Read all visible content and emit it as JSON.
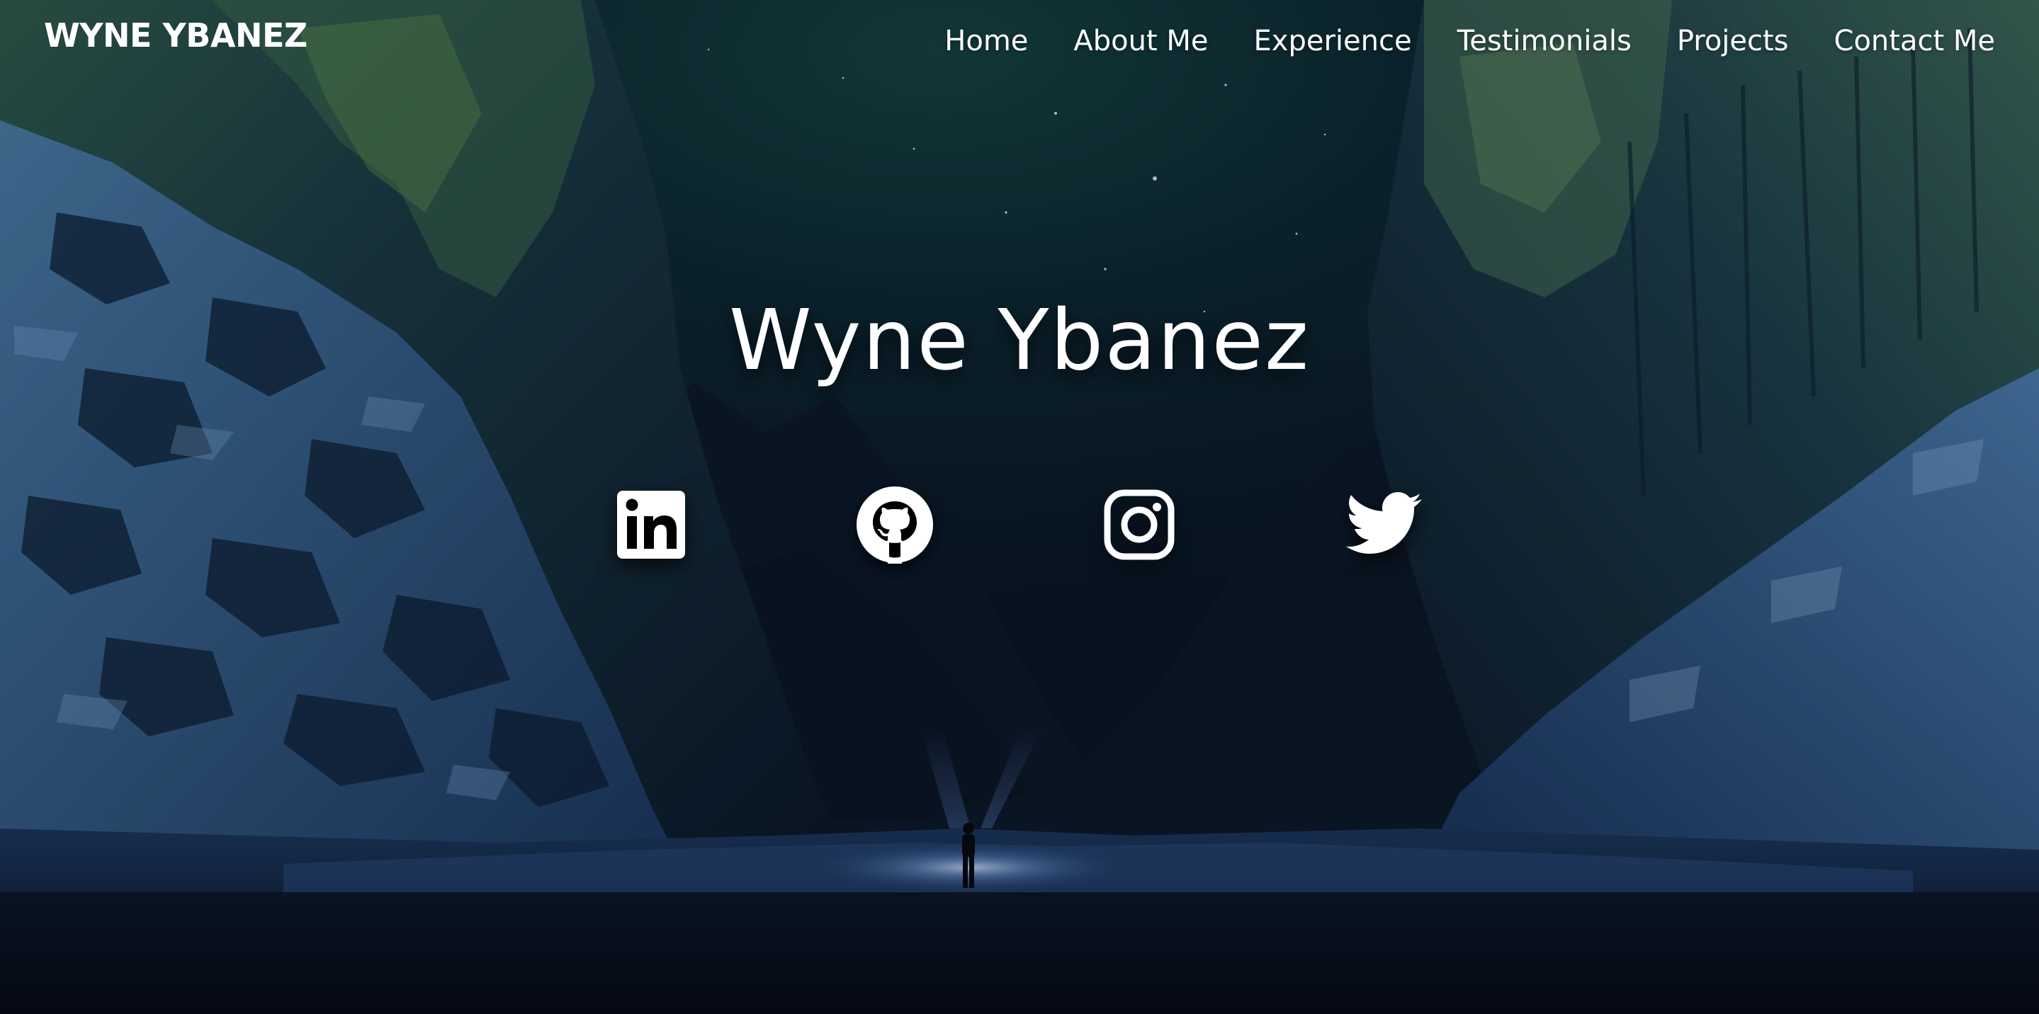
{
  "header": {
    "brand": "WYNE YBANEZ",
    "nav": [
      {
        "label": "Home"
      },
      {
        "label": "About Me"
      },
      {
        "label": "Experience"
      },
      {
        "label": "Testimonials"
      },
      {
        "label": "Projects"
      },
      {
        "label": "Contact Me"
      }
    ]
  },
  "hero": {
    "name": "Wyne Ybanez"
  },
  "socials": [
    {
      "icon": "linkedin-icon"
    },
    {
      "icon": "github-icon"
    },
    {
      "icon": "instagram-icon"
    },
    {
      "icon": "twitter-icon"
    }
  ],
  "colors": {
    "text": "#ffffff",
    "sky": "#0c2230",
    "rock_glow": "#3f6a5a",
    "snow": "#3c6aa3",
    "shadow": "#060c17"
  }
}
